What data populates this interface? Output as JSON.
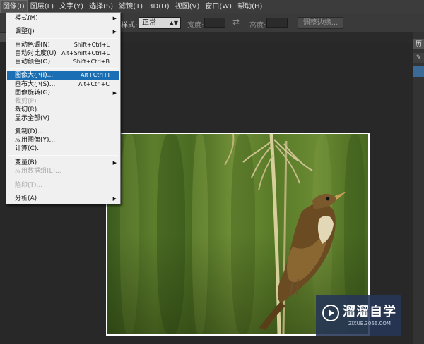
{
  "menubar": {
    "items": [
      {
        "label": "图像(I)",
        "active": true
      },
      {
        "label": "图层(L)"
      },
      {
        "label": "文字(Y)"
      },
      {
        "label": "选择(S)"
      },
      {
        "label": "滤镜(T)"
      },
      {
        "label": "3D(D)"
      },
      {
        "label": "视图(V)"
      },
      {
        "label": "窗口(W)"
      },
      {
        "label": "帮助(H)"
      }
    ]
  },
  "options_bar": {
    "style_label": "样式:",
    "style_value": "正常",
    "width_label": "宽度:",
    "height_label": "高度:",
    "refine_edge_button": "调整边缘..."
  },
  "right_panel": {
    "tab_label": "历"
  },
  "image_menu": {
    "items": [
      {
        "label": "模式(M)",
        "submenu": true
      },
      {
        "label": "调整(J)",
        "submenu": true
      },
      {
        "label": "自动色调(N)",
        "shortcut": "Shift+Ctrl+L"
      },
      {
        "label": "自动对比度(U)",
        "shortcut": "Alt+Shift+Ctrl+L"
      },
      {
        "label": "自动颜色(O)",
        "shortcut": "Shift+Ctrl+B"
      },
      {
        "label": "图像大小(I)...",
        "shortcut": "Alt+Ctrl+I",
        "highlighted": true
      },
      {
        "label": "画布大小(S)...",
        "shortcut": "Alt+Ctrl+C"
      },
      {
        "label": "图像旋转(G)",
        "submenu": true
      },
      {
        "label": "裁剪(P)",
        "disabled": true
      },
      {
        "label": "裁切(R)..."
      },
      {
        "label": "显示全部(V)"
      },
      {
        "label": "复制(D)..."
      },
      {
        "label": "应用图像(Y)..."
      },
      {
        "label": "计算(C)..."
      },
      {
        "label": "变量(B)",
        "submenu": true
      },
      {
        "label": "应用数据组(L)...",
        "disabled": true
      },
      {
        "label": "陷印(T)...",
        "disabled": true
      },
      {
        "label": "分析(A)",
        "submenu": true
      }
    ]
  },
  "watermark": {
    "title": "溜溜自学",
    "url": "ZIXUE.3066.COM"
  },
  "colors": {
    "menu_highlight": "#1a6fb4",
    "app_background": "#282828",
    "menu_background": "#f0f0f0"
  }
}
